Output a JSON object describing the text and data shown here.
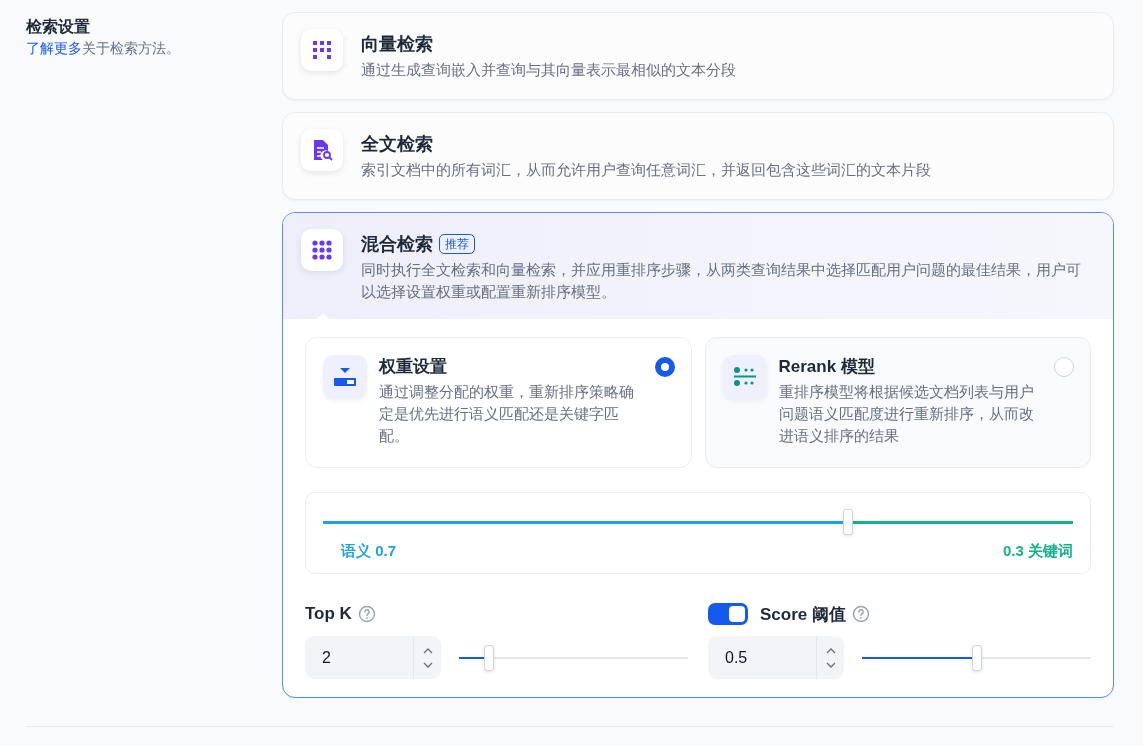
{
  "sidebar": {
    "title": "检索设置",
    "link": "了解更多",
    "text": "关于检索方法。"
  },
  "methods": [
    {
      "kind": "vector",
      "title": "向量检索",
      "description": "通过生成查询嵌入并查询与其向量表示最相似的文本分段",
      "selected": false
    },
    {
      "kind": "fulltext",
      "title": "全文检索",
      "description": "索引文档中的所有词汇，从而允许用户查询任意词汇，并返回包含这些词汇的文本片段",
      "selected": false
    },
    {
      "kind": "hybrid",
      "title": "混合检索",
      "badge": "推荐",
      "description": "同时执行全文检索和向量检索，并应用重排序步骤，从两类查询结果中选择匹配用户问题的最佳结果，用户可以选择设置权重或配置重新排序模型。",
      "selected": true
    }
  ],
  "hybrid": {
    "options": [
      {
        "kind": "weight",
        "title": "权重设置",
        "description": "通过调整分配的权重，重新排序策略确定是优先进行语义匹配还是关键字匹配。",
        "selected": true
      },
      {
        "kind": "rerank",
        "title": "Rerank 模型",
        "description": "重排序模型将根据候选文档列表与用户问题语义匹配度进行重新排序，从而改进语义排序的结果",
        "selected": false
      }
    ],
    "weight_slider": {
      "level": 0.7,
      "left_label": "语义 0.7",
      "right_label": "0.3 关键词"
    },
    "top_k": {
      "label": "Top K",
      "value": "2",
      "level": 0.13
    },
    "score": {
      "label": "Score 阈值",
      "on": true,
      "value": "0.5",
      "level": 0.5
    }
  }
}
